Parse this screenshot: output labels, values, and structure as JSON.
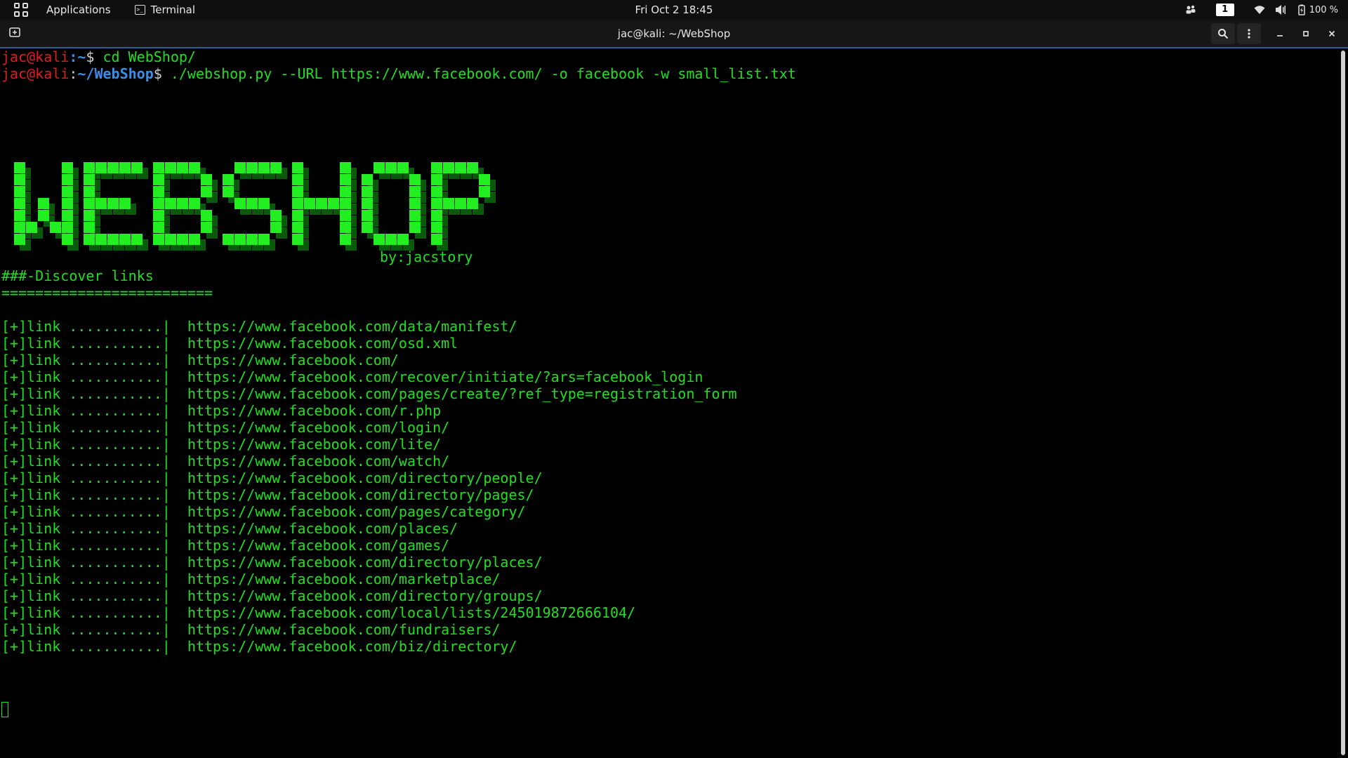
{
  "topbar": {
    "applications_label": "Applications",
    "terminal_label": "Terminal",
    "clock": "Fri Oct 2  18:45",
    "workspace": "1",
    "battery": "100 %"
  },
  "window": {
    "title": "jac@kali: ~/WebShop"
  },
  "terminal": {
    "prompt1_user": "jac@kali",
    "prompt1_path": ":~",
    "prompt1_sym": "$",
    "cmd1": " cd WebShop/",
    "prompt2_user": "jac@kali",
    "prompt2_sep": ":",
    "prompt2_path": "~/WebShop",
    "prompt2_sym": "$",
    "cmd2": " ./webshop.py --URL https://www.facebook.com/ -o facebook -w small_list.txt",
    "logo_text": "WEBSHOP",
    "byline": "by:jacstory",
    "section_title": "###-Discover links",
    "section_rule": "=========================",
    "link_prefix": "[+]link ...........|  ",
    "links": [
      "https://www.facebook.com/data/manifest/",
      "https://www.facebook.com/osd.xml",
      "https://www.facebook.com/",
      "https://www.facebook.com/recover/initiate/?ars=facebook_login",
      "https://www.facebook.com/pages/create/?ref_type=registration_form",
      "https://www.facebook.com/r.php",
      "https://www.facebook.com/login/",
      "https://www.facebook.com/lite/",
      "https://www.facebook.com/watch/",
      "https://www.facebook.com/directory/people/",
      "https://www.facebook.com/directory/pages/",
      "https://www.facebook.com/pages/category/",
      "https://www.facebook.com/places/",
      "https://www.facebook.com/games/",
      "https://www.facebook.com/directory/places/",
      "https://www.facebook.com/marketplace/",
      "https://www.facebook.com/directory/groups/",
      "https://www.facebook.com/local/lists/245019872666104/",
      "https://www.facebook.com/fundraisers/",
      "https://www.facebook.com/biz/directory/"
    ]
  },
  "colors": {
    "terminal_green": "#1ee01e",
    "prompt_red": "#e21c1c",
    "prompt_blue": "#3c8fe8",
    "window_accent": "#2d5f9e"
  }
}
